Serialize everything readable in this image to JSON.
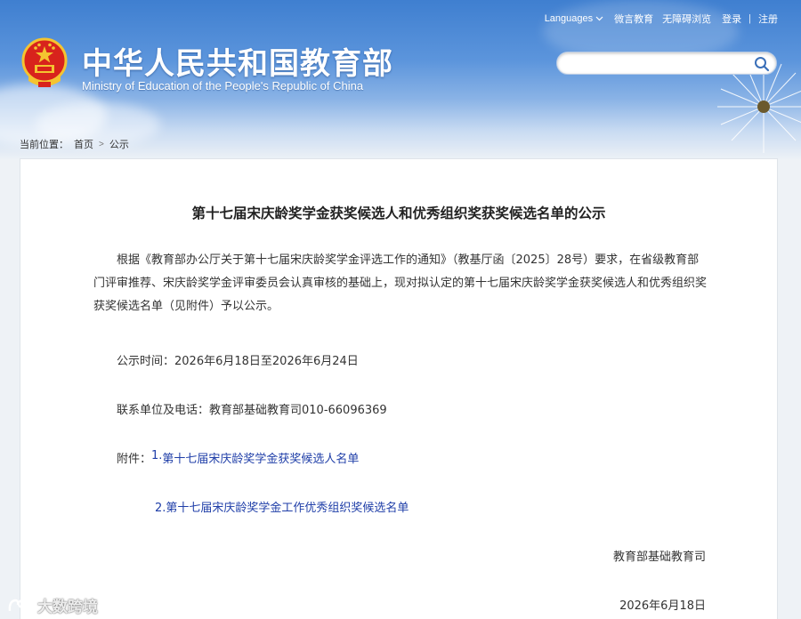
{
  "header": {
    "title": "中华人民共和国教育部",
    "subtitle": "Ministry of Education of the People's Republic of China",
    "nav": {
      "languages": "Languages",
      "weibo": "微言教育",
      "accessibility": "无障碍浏览",
      "login": "登录",
      "separator": "|",
      "register": "注册"
    },
    "search": {
      "value": "",
      "placeholder": ""
    }
  },
  "breadcrumb": {
    "label": "当前位置：",
    "home": "首页",
    "separator": ">",
    "current": "公示"
  },
  "article": {
    "title": "第十七届宋庆龄奖学金获奖候选人和优秀组织奖获奖候选名单的公示",
    "intro": "根据《教育部办公厅关于第十七届宋庆龄奖学金评选工作的通知》（教基厅函〔2025〕28号）要求，在省级教育部门评审推荐、宋庆龄奖学金评审委员会认真审核的基础上，现对拟认定的第十七届宋庆龄奖学金获奖候选人和优秀组织奖获奖候选名单（见附件）予以公示。",
    "time": "公示时间：2026年6月18日至2026年6月24日",
    "contact": "联系单位及电话：教育部基础教育司010-66096369",
    "attachments_label": "附件：",
    "attachments": [
      {
        "num": "1.",
        "label": "第十七届宋庆龄奖学金获奖候选人名单"
      },
      {
        "num": "2.",
        "label": "第十七届宋庆龄奖学金工作优秀组织奖候选名单"
      }
    ],
    "signature": "教育部基础教育司",
    "date": "2026年6月18日"
  },
  "watermark": {
    "text": "大数跨境"
  },
  "colors": {
    "header_blue": "#3f7fd0",
    "link_blue": "#1f3ea8",
    "emblem_red": "#d8231c",
    "emblem_gold": "#f4c430"
  }
}
